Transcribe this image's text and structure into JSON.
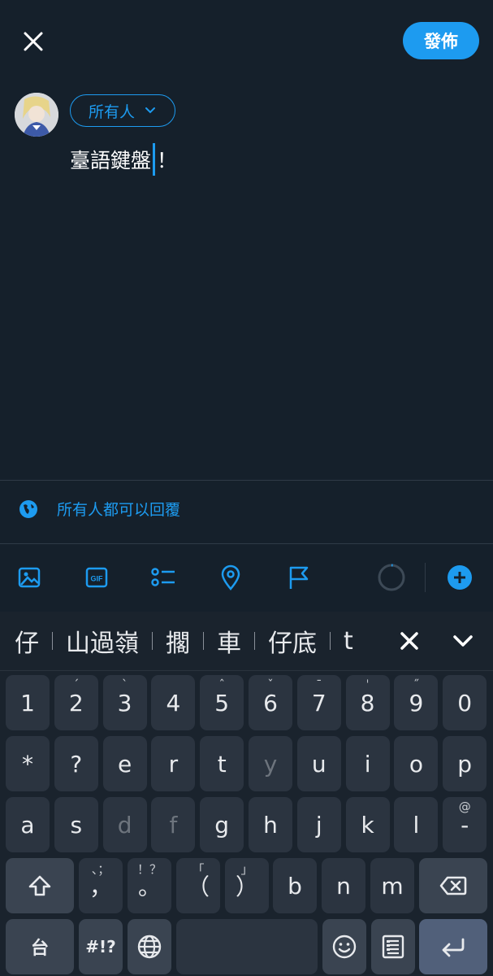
{
  "header": {
    "post_label": "發佈"
  },
  "compose": {
    "audience_label": "所有人",
    "text_before_caret": "臺語鍵盤",
    "text_after_caret": "！"
  },
  "reply_setting": {
    "label": "所有人都可以回覆"
  },
  "toolbar": {
    "icons": [
      "image-icon",
      "gif-icon",
      "poll-icon",
      "location-icon",
      "flag-icon",
      "progress-ring-icon",
      "add-icon"
    ],
    "gif_label": "GIF"
  },
  "keyboard": {
    "suggestions": [
      "仔",
      "山過嶺",
      "擱",
      "車",
      "仔底",
      "t"
    ],
    "row_numbers": [
      {
        "label": "1",
        "hint": ""
      },
      {
        "label": "2",
        "hint": "ˊ"
      },
      {
        "label": "3",
        "hint": "ˋ"
      },
      {
        "label": "4",
        "hint": ""
      },
      {
        "label": "5",
        "hint": "ˆ"
      },
      {
        "label": "6",
        "hint": "ˇ"
      },
      {
        "label": "7",
        "hint": "ˉ"
      },
      {
        "label": "8",
        "hint": "ˈ"
      },
      {
        "label": "9",
        "hint": "˝"
      },
      {
        "label": "0",
        "hint": ""
      }
    ],
    "row_top": [
      "*",
      "?",
      "e",
      "r",
      "t",
      "y",
      "u",
      "i",
      "o",
      "p"
    ],
    "row_mid": [
      "a",
      "s",
      "d",
      "f",
      "g",
      "h",
      "j",
      "k",
      "l",
      "-"
    ],
    "row_mid_hint_last": "@",
    "row_bottom": [
      {
        "label": "，",
        "hint": "、；"
      },
      {
        "label": "。",
        "hint": "！？"
      },
      {
        "label": "（",
        "hint": "「"
      },
      {
        "label": "）",
        "hint": "」"
      },
      {
        "label": "b",
        "hint": ""
      },
      {
        "label": "n",
        "hint": ""
      },
      {
        "label": "m",
        "hint": ""
      }
    ],
    "lang_key": "台",
    "symbols_key": "#!?"
  },
  "colors": {
    "background": "#15202b",
    "accent": "#1d9bf0",
    "keyboard_bg": "#1a232d",
    "key": "#2b3440"
  }
}
